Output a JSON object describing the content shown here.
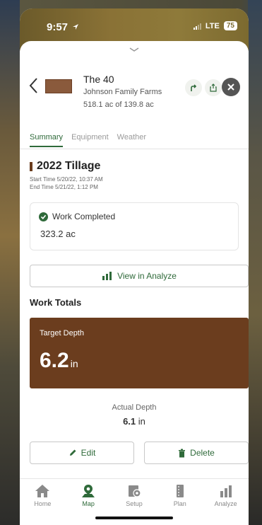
{
  "status_bar": {
    "time": "9:57",
    "network": "LTE",
    "battery": "75"
  },
  "field": {
    "name": "The 40",
    "farm": "Johnson Family Farms",
    "acres": "518.1 ac of 139.8 ac"
  },
  "tabs": [
    "Summary",
    "Equipment",
    "Weather"
  ],
  "operation": {
    "title": "2022 Tillage",
    "start": "Start Time 5/20/22, 10:37 AM",
    "end": "End Time 5/21/22, 1:12 PM"
  },
  "work_completed": {
    "label": "Work Completed",
    "value": "323.2 ac"
  },
  "analyze_button": "View in Analyze",
  "work_totals": {
    "title": "Work Totals",
    "target_label": "Target Depth",
    "target_value": "6.2",
    "target_unit": "in",
    "actual_label": "Actual Depth",
    "actual_value": "6.1",
    "actual_unit": "in"
  },
  "actions": {
    "edit": "Edit",
    "delete": "Delete"
  },
  "tabbar": {
    "home": "Home",
    "map": "Map",
    "setup": "Setup",
    "plan": "Plan",
    "analyze": "Analyze"
  },
  "colors": {
    "accent_green": "#2f6a3a",
    "tillage_brown": "#6b3d1e"
  }
}
